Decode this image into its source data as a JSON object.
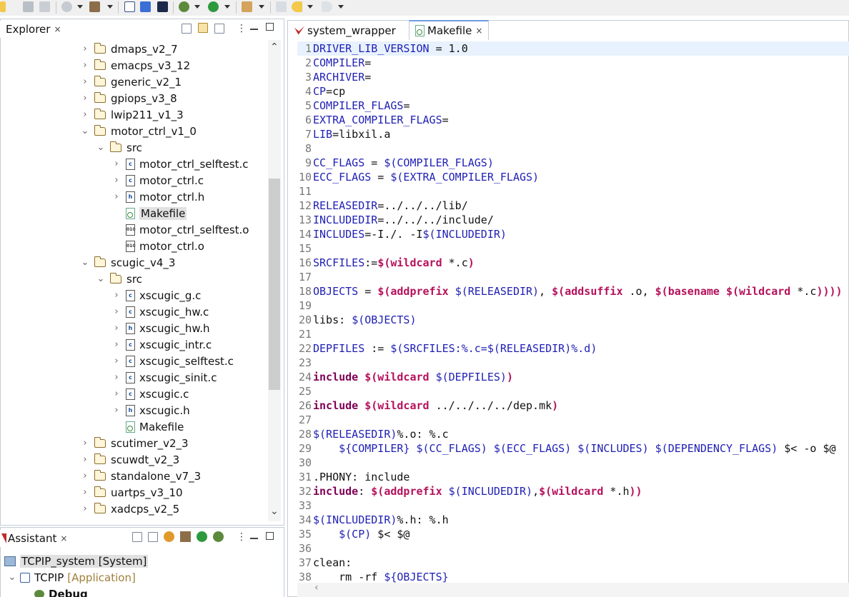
{
  "explorer": {
    "tab_label": "Explorer",
    "close_glyph": "×",
    "items": [
      {
        "label": "dmaps_v2_7",
        "type": "folder",
        "expanded": false
      },
      {
        "label": "emacps_v3_12",
        "type": "folder",
        "expanded": false
      },
      {
        "label": "generic_v2_1",
        "type": "folder",
        "expanded": false
      },
      {
        "label": "gpiops_v3_8",
        "type": "folder",
        "expanded": false
      },
      {
        "label": "lwip211_v1_3",
        "type": "folder",
        "expanded": false
      },
      {
        "label": "motor_ctrl_v1_0",
        "type": "folder",
        "expanded": true
      },
      {
        "label": "src",
        "type": "folder",
        "expanded": true
      },
      {
        "label": "motor_ctrl_selftest.c",
        "type": "c"
      },
      {
        "label": "motor_ctrl.c",
        "type": "c"
      },
      {
        "label": "motor_ctrl.h",
        "type": "h"
      },
      {
        "label": "Makefile",
        "type": "makefile",
        "selected": true
      },
      {
        "label": "motor_ctrl_selftest.o",
        "type": "o"
      },
      {
        "label": "motor_ctrl.o",
        "type": "o"
      },
      {
        "label": "scugic_v4_3",
        "type": "folder",
        "expanded": true
      },
      {
        "label": "src",
        "type": "folder",
        "expanded": true
      },
      {
        "label": "xscugic_g.c",
        "type": "c"
      },
      {
        "label": "xscugic_hw.c",
        "type": "c"
      },
      {
        "label": "xscugic_hw.h",
        "type": "h"
      },
      {
        "label": "xscugic_intr.c",
        "type": "c"
      },
      {
        "label": "xscugic_selftest.c",
        "type": "c"
      },
      {
        "label": "xscugic_sinit.c",
        "type": "c"
      },
      {
        "label": "xscugic.c",
        "type": "c"
      },
      {
        "label": "xscugic.h",
        "type": "h"
      },
      {
        "label": "Makefile",
        "type": "makefile"
      },
      {
        "label": "scutimer_v2_3",
        "type": "folder",
        "expanded": false
      },
      {
        "label": "scuwdt_v2_3",
        "type": "folder",
        "expanded": false
      },
      {
        "label": "standalone_v7_3",
        "type": "folder",
        "expanded": false
      },
      {
        "label": "uartps_v3_10",
        "type": "folder",
        "expanded": false
      },
      {
        "label": "xadcps_v2_5",
        "type": "folder",
        "expanded": false
      }
    ]
  },
  "assistant": {
    "tab_label": "Assistant",
    "close_glyph": "×",
    "system_label": "TCPIP_system [System]",
    "app_name": "TCPIP",
    "app_tag": "[Application]",
    "debug_label": "Debug"
  },
  "editor": {
    "tabs": [
      {
        "label": "system_wrapper",
        "active": false
      },
      {
        "label": "Makefile",
        "active": true
      }
    ],
    "close_glyph": "×",
    "lines": [
      [
        [
          "DRIVER_LIB_VERSION",
          "var"
        ],
        [
          " = 1.0",
          "pl"
        ]
      ],
      [
        [
          "COMPILER",
          "var"
        ],
        [
          "=",
          "pl"
        ]
      ],
      [
        [
          "ARCHIVER",
          "var"
        ],
        [
          "=",
          "pl"
        ]
      ],
      [
        [
          "CP",
          "var"
        ],
        [
          "=cp",
          "pl"
        ]
      ],
      [
        [
          "COMPILER_FLAGS",
          "var"
        ],
        [
          "=",
          "pl"
        ]
      ],
      [
        [
          "EXTRA_COMPILER_FLAGS",
          "var"
        ],
        [
          "=",
          "pl"
        ]
      ],
      [
        [
          "LIB",
          "var"
        ],
        [
          "=libxil.a",
          "pl"
        ]
      ],
      [],
      [
        [
          "CC_FLAGS",
          "var"
        ],
        [
          " = ",
          "pl"
        ],
        [
          "$(COMPILER_FLAGS)",
          "ref"
        ]
      ],
      [
        [
          "ECC_FLAGS",
          "var"
        ],
        [
          " = ",
          "pl"
        ],
        [
          "$(EXTRA_COMPILER_FLAGS)",
          "ref"
        ]
      ],
      [],
      [
        [
          "RELEASEDIR",
          "var"
        ],
        [
          "=../../../lib/",
          "pl"
        ]
      ],
      [
        [
          "INCLUDEDIR",
          "var"
        ],
        [
          "=../../../include/",
          "pl"
        ]
      ],
      [
        [
          "INCLUDES",
          "var"
        ],
        [
          "=-I./. -I",
          "pl"
        ],
        [
          "$(INCLUDEDIR)",
          "ref"
        ]
      ],
      [],
      [
        [
          "SRCFILES",
          "var"
        ],
        [
          ":=",
          "pl"
        ],
        [
          "$(wildcard",
          "fn"
        ],
        [
          " *.c",
          "pl"
        ],
        [
          ")",
          "fn"
        ]
      ],
      [],
      [
        [
          "OBJECTS",
          "var"
        ],
        [
          " = ",
          "pl"
        ],
        [
          "$(addprefix",
          "fn"
        ],
        [
          " ",
          "pl"
        ],
        [
          "$(RELEASEDIR)",
          "ref"
        ],
        [
          ", ",
          "pl"
        ],
        [
          "$(addsuffix",
          "fn"
        ],
        [
          " .o, ",
          "pl"
        ],
        [
          "$(basename",
          "fn"
        ],
        [
          " ",
          "pl"
        ],
        [
          "$(wildcard",
          "fn"
        ],
        [
          " *.c",
          "pl"
        ],
        [
          "))))",
          "fn"
        ]
      ],
      [],
      [
        [
          "libs: ",
          "pl"
        ],
        [
          "$(OBJECTS)",
          "ref"
        ]
      ],
      [],
      [
        [
          "DEPFILES",
          "var"
        ],
        [
          " := ",
          "pl"
        ],
        [
          "$(SRCFILES:%.c=$(RELEASEDIR)%.d)",
          "ref"
        ]
      ],
      [],
      [
        [
          "include",
          "kw"
        ],
        [
          " ",
          "pl"
        ],
        [
          "$(wildcard",
          "fn"
        ],
        [
          " ",
          "pl"
        ],
        [
          "$(DEPFILES)",
          "ref"
        ],
        [
          ")",
          "fn"
        ]
      ],
      [],
      [
        [
          "include",
          "kw"
        ],
        [
          " ",
          "pl"
        ],
        [
          "$(wildcard",
          "fn"
        ],
        [
          " ../../../../dep.mk",
          "pl"
        ],
        [
          ")",
          "fn"
        ]
      ],
      [],
      [
        [
          "$(RELEASEDIR)",
          "ref"
        ],
        [
          "%.o: %.c",
          "pl"
        ]
      ],
      [
        [
          "    ",
          "pl"
        ],
        [
          "${COMPILER}",
          "ref"
        ],
        [
          " ",
          "pl"
        ],
        [
          "$(CC_FLAGS)",
          "ref"
        ],
        [
          " ",
          "pl"
        ],
        [
          "$(ECC_FLAGS)",
          "ref"
        ],
        [
          " ",
          "pl"
        ],
        [
          "$(INCLUDES)",
          "ref"
        ],
        [
          " ",
          "pl"
        ],
        [
          "$(DEPENDENCY_FLAGS)",
          "ref"
        ],
        [
          " $< -o $@",
          "pl"
        ]
      ],
      [],
      [
        [
          ".PHONY: include",
          "pl"
        ]
      ],
      [
        [
          "include",
          "kw"
        ],
        [
          ": ",
          "pl"
        ],
        [
          "$(addprefix",
          "fn"
        ],
        [
          " ",
          "pl"
        ],
        [
          "$(INCLUDEDIR)",
          "ref"
        ],
        [
          ",",
          "pl"
        ],
        [
          "$(wildcard",
          "fn"
        ],
        [
          " *.h",
          "pl"
        ],
        [
          "))",
          "fn"
        ]
      ],
      [],
      [
        [
          "$(INCLUDEDIR)",
          "ref"
        ],
        [
          "%.h: %.h",
          "pl"
        ]
      ],
      [
        [
          "    ",
          "pl"
        ],
        [
          "$(CP)",
          "ref"
        ],
        [
          " $< $@",
          "pl"
        ]
      ],
      [],
      [
        [
          "clean:",
          "pl"
        ]
      ],
      [
        [
          "    rm -rf ",
          "pl"
        ],
        [
          "${OBJECTS}",
          "ref"
        ]
      ]
    ]
  },
  "colors": {
    "accent_blue": "#1f1fb5",
    "function_red": "#b5115c",
    "keyword_purple": "#7f0055",
    "line_number_gray": "#787878"
  }
}
